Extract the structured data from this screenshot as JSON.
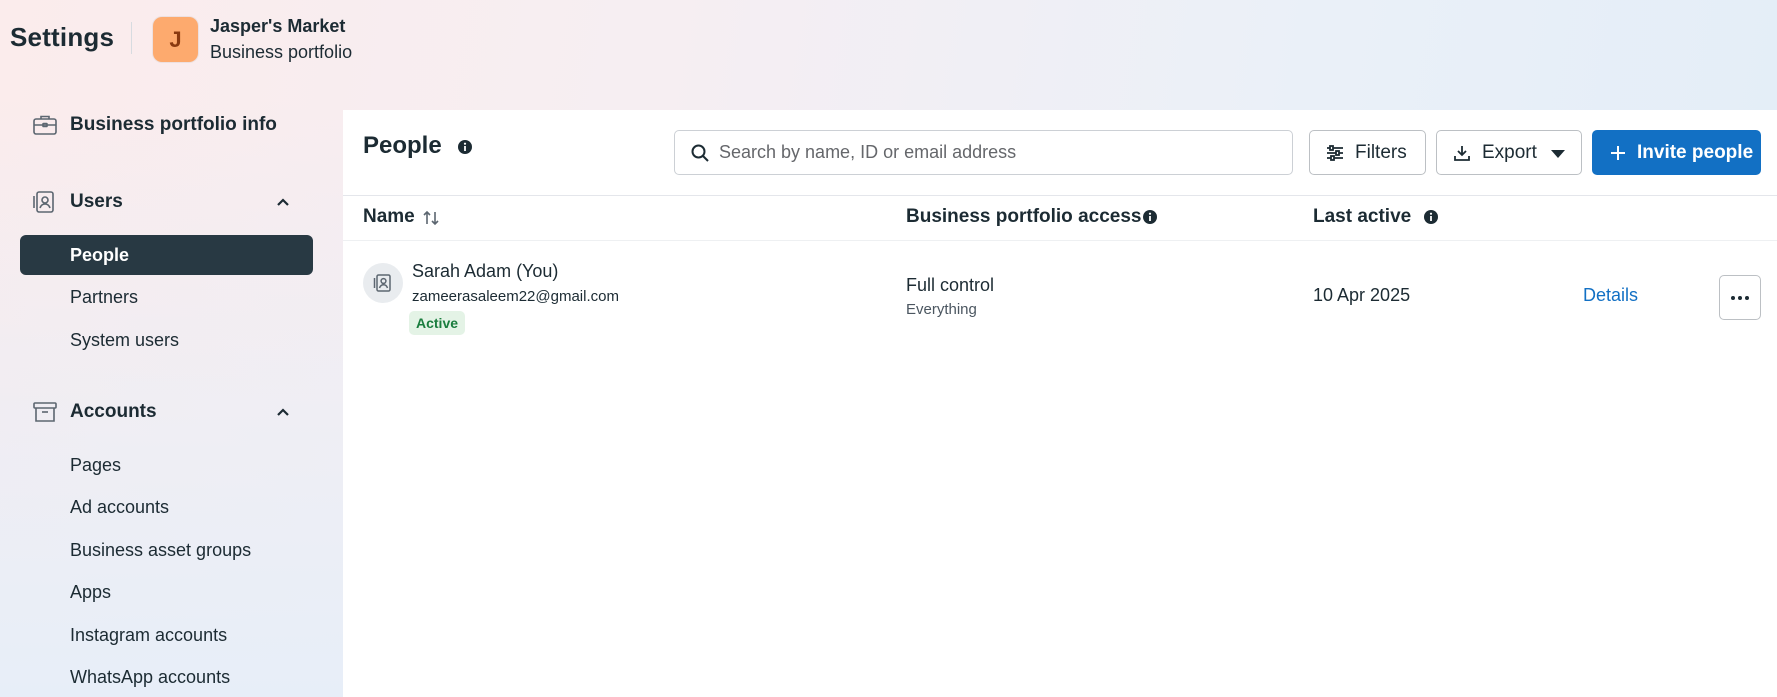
{
  "header": {
    "title": "Settings",
    "business": {
      "initial": "J",
      "name": "Jasper's Market",
      "subtitle": "Business portfolio"
    }
  },
  "sidebar": {
    "portfolio_info": {
      "label": "Business portfolio info",
      "icon": "briefcase-icon"
    },
    "users": {
      "label": "Users",
      "icon": "id-badge-icon",
      "expanded": true,
      "items": [
        {
          "label": "People",
          "active": true
        },
        {
          "label": "Partners",
          "active": false
        },
        {
          "label": "System users",
          "active": false
        }
      ]
    },
    "accounts": {
      "label": "Accounts",
      "icon": "archive-box-icon",
      "expanded": true,
      "items": [
        {
          "label": "Pages"
        },
        {
          "label": "Ad accounts"
        },
        {
          "label": "Business asset groups"
        },
        {
          "label": "Apps"
        },
        {
          "label": "Instagram accounts"
        },
        {
          "label": "WhatsApp accounts"
        }
      ]
    }
  },
  "main": {
    "title": "People",
    "search": {
      "placeholder": "Search by name, ID or email address",
      "value": ""
    },
    "toolbar": {
      "filters_label": "Filters",
      "export_label": "Export",
      "invite_label": "Invite people"
    },
    "table": {
      "columns": {
        "name": "Name",
        "access": "Business portfolio access",
        "last_active": "Last active"
      },
      "rows": [
        {
          "name": "Sarah Adam (You)",
          "email": "zameerasaleem22@gmail.com",
          "status": "Active",
          "access": "Full control",
          "access_detail": "Everything",
          "last_active": "10 Apr 2025",
          "details_label": "Details"
        }
      ]
    }
  },
  "colors": {
    "primary": "#1270c4",
    "active_nav": "#283943",
    "status_active_bg": "#e4f3e6",
    "status_active_text": "#1a7d3e",
    "avatar_bg": "#fdaa6e"
  }
}
